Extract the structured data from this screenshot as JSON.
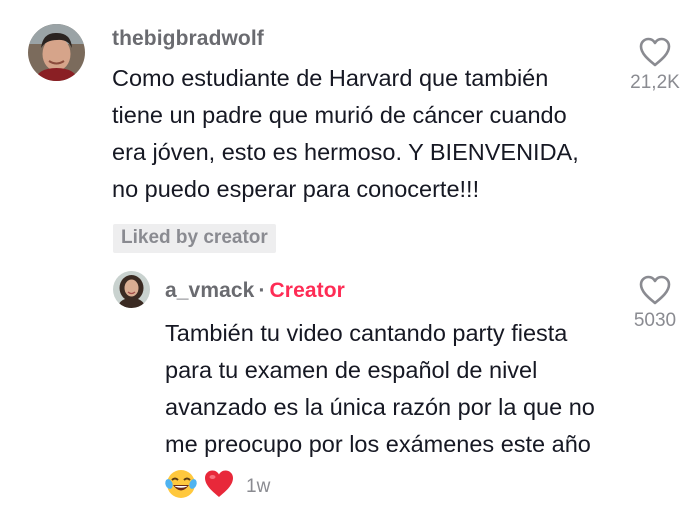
{
  "comment": {
    "username": "thebigbradwolf",
    "text_lines": [
      "Como estudiante de Harvard que también",
      "tiene un padre que murió de cáncer cuando",
      "era jóven, esto es hermoso. Y BIENVENIDA,",
      "no puedo esperar para conocerte!!!"
    ],
    "liked_badge": "Liked by creator",
    "like_count": "21,2K",
    "like_icon": "heart-outline-icon"
  },
  "reply": {
    "username": "a_vmack",
    "separator": "·",
    "creator_label": "Creator",
    "text_lines": [
      "También tu video cantando party fiesta",
      "para tu examen de español de nivel",
      "avanzado es la única razón por la que no",
      "me preocupo por los exámenes este año"
    ],
    "emojis": [
      "laughing-tears-emoji",
      "red-heart-emoji"
    ],
    "timestamp": "1w",
    "like_count": "5030",
    "like_icon": "heart-outline-icon"
  },
  "colors": {
    "accent_creator": "#fe2c55",
    "username_gray": "#6a6b70",
    "meta_gray": "#8a8b91",
    "badge_bg": "#eeeeef",
    "text": "#161823"
  }
}
